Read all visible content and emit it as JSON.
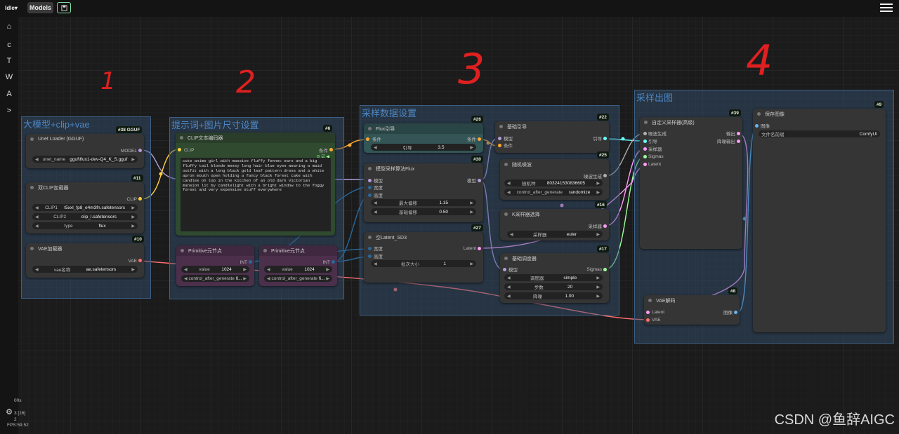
{
  "topbar": {
    "logo_text": "Idle",
    "models_label": "Models",
    "save_icon": "save-icon",
    "menu_icon": "hamburger-menu-icon"
  },
  "sidebar": {
    "items": [
      {
        "icon": "home-icon",
        "glyph": "⌂"
      },
      {
        "icon": "refresh-icon",
        "glyph": "c"
      },
      {
        "icon": "text-tool-icon",
        "glyph": "T"
      },
      {
        "icon": "w-tool-icon",
        "glyph": "W"
      },
      {
        "icon": "a-tool-icon",
        "glyph": "A"
      },
      {
        "icon": "expand-icon",
        "glyph": ">"
      }
    ],
    "settings_icon": "gear-icon"
  },
  "annotations": [
    "1",
    "2",
    "3",
    "4"
  ],
  "groups": {
    "g1": "大模型+clip+vae",
    "g2": "提示词+图片尺寸设置",
    "g3": "采样数据设置",
    "g4": "采样出图"
  },
  "nodes": {
    "unet": {
      "title": "Unet Loader (GGUF)",
      "badge": "#38 GGUF",
      "output": "MODEL",
      "w_label": "unet_name",
      "w_value": "gguf\\flux1-dev-Q4_K_S.gguf"
    },
    "dualclip": {
      "title": "双CLIP加载器",
      "badge": "#11",
      "output": "CLIP",
      "widgets": [
        {
          "label": "CLIP1",
          "value": "t5xxl_fp8_e4m3fn.safetensors"
        },
        {
          "label": "CLIP2",
          "value": "clip_l.safetensors"
        },
        {
          "label": "type",
          "value": "flux"
        }
      ]
    },
    "vaeloader": {
      "title": "VAE加载器",
      "badge": "#10",
      "output": "VAE",
      "w_label": "vae名称",
      "w_value": "ae.safetensors"
    },
    "clipenc": {
      "title": "CLIP文本编码器",
      "badge": "#6",
      "input": "CLIP",
      "output": "条件",
      "text": "cute anime girl with massive fluffy fennec ears and a big fluffy tail blonde messy long hair blue eyes wearing a maid outfit with a long black gold leaf pattern dress and a white apron mouth open holding a fancy black forest cake with candles on top in the kitchen of an old dark Victorian mansion lit by candlelight with a bright window to the foggy forest and very expensive stuff everywhere"
    },
    "prim1": {
      "title": "Primitive元节点",
      "output": "INT",
      "widgets": [
        {
          "label": "value",
          "value": "1024"
        },
        {
          "label": "control_after_generate",
          "value": "fi..."
        }
      ]
    },
    "prim2": {
      "title": "Primitive元节点",
      "output": "INT",
      "widgets": [
        {
          "label": "value",
          "value": "1024"
        },
        {
          "label": "control_after_generate",
          "value": "fi..."
        }
      ]
    },
    "flux": {
      "title": "Flux引导",
      "badge": "#26",
      "input": "条件",
      "output": "条件",
      "w_label": "引导",
      "w_value": "3.5"
    },
    "modelsamp": {
      "title": "模型采样算法Flux",
      "badge": "#30",
      "inputs": [
        "模型",
        "宽度",
        "高度"
      ],
      "output": "模型",
      "widgets": [
        {
          "label": "最大偏移",
          "value": "1.15"
        },
        {
          "label": "基础偏移",
          "value": "0.50"
        }
      ]
    },
    "latent": {
      "title": "空Latent_SD3",
      "badge": "#27",
      "inputs": [
        "宽度",
        "高度"
      ],
      "output": "Latent",
      "w_label": "批次大小",
      "w_value": "1"
    },
    "guider": {
      "title": "基础引导",
      "badge": "#22",
      "inputs": [
        "模型",
        "条件"
      ],
      "output": "引导"
    },
    "noise": {
      "title": "随机噪波",
      "badge": "#25",
      "output": "噪波生成",
      "widgets": [
        {
          "label": "随机种",
          "value": "803241530836605"
        },
        {
          "label": "control_after_generate",
          "value": "randomize"
        }
      ]
    },
    "ksel": {
      "title": "K采样器选择",
      "badge": "#16",
      "output": "采样器",
      "w_label": "采样器",
      "w_value": "euler"
    },
    "sched": {
      "title": "基础调度器",
      "badge": "#17",
      "input": "模型",
      "output": "Sigmas",
      "widgets": [
        {
          "label": "调度器",
          "value": "simple"
        },
        {
          "label": "步数",
          "value": "20"
        },
        {
          "label": "降噪",
          "value": "1.00"
        }
      ]
    },
    "custsamp": {
      "title": "自定义采样器(高级)",
      "badge": "#39",
      "inputs": [
        "噪波生成",
        "引导",
        "采样器",
        "Sigmas",
        "Latent"
      ],
      "outputs": [
        "输出",
        "降噪输出"
      ]
    },
    "vaedec": {
      "title": "VAE解码",
      "badge": "#8",
      "inputs": [
        "Latent",
        "VAE"
      ],
      "output": "图像"
    },
    "save": {
      "title": "保存图像",
      "badge": "#9",
      "input": "图像",
      "w_label": "文件名前缀",
      "w_value": "ComfyUI"
    }
  },
  "status": {
    "line1": "00s",
    "line2": "3 [16]",
    "line3": "2",
    "fps": "FPS:59.52"
  },
  "watermark": "CSDN @鱼辞AIGC",
  "colors": {
    "clip": "#ffd23f",
    "model": "#b39ddb",
    "vae": "#ff6e6e",
    "conditioning": "#ffa931",
    "int": "#29699c",
    "latent": "#ff9cf9",
    "sigmas": "#9cff9c",
    "noise": "#b0b0b0",
    "guider": "#66ffff",
    "image": "#64b5f6"
  }
}
